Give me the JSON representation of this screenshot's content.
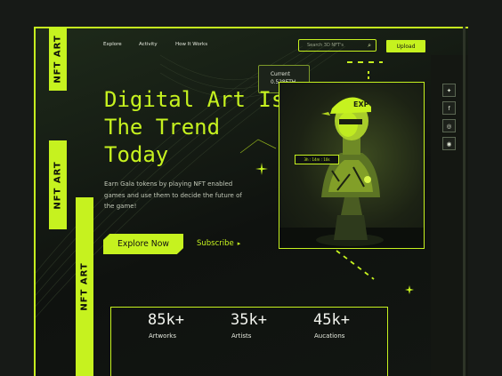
{
  "colors": {
    "accent": "#c6f21f",
    "background": "#171a17",
    "panel": "#121612"
  },
  "side_labels": [
    "NFT ART",
    "NFT ART",
    "NFT ART"
  ],
  "nav": {
    "items": [
      {
        "label": "Explore"
      },
      {
        "label": "Activity"
      },
      {
        "label": "How It Works"
      }
    ]
  },
  "search": {
    "placeholder": "Search 3D NFT's",
    "icon": "search-icon"
  },
  "upload_label": "Upload",
  "current": {
    "label": "Current",
    "value": "0.528ETH"
  },
  "hero": {
    "lines": [
      "Digital Art Is",
      "The Trend",
      "Today"
    ],
    "description": "Earn Gala tokens by playing NFT enabled games and use them to decide the future of the game!",
    "explore_label": "Explore Now",
    "subscribe_label": "Subscribe",
    "subscribe_icon": "play-arrow-icon"
  },
  "artwork": {
    "tag": "3h : 14m : 10s",
    "subject": "bust-statue-image"
  },
  "social": [
    {
      "icon": "twitter-icon",
      "glyph": "✦"
    },
    {
      "icon": "facebook-icon",
      "glyph": "f"
    },
    {
      "icon": "instagram-icon",
      "glyph": "◎"
    },
    {
      "icon": "discord-icon",
      "glyph": "◉"
    }
  ],
  "stats": [
    {
      "value": "85k+",
      "label": "Artworks"
    },
    {
      "value": "35k+",
      "label": "Artists"
    },
    {
      "value": "45k+",
      "label": "Aucations"
    }
  ]
}
